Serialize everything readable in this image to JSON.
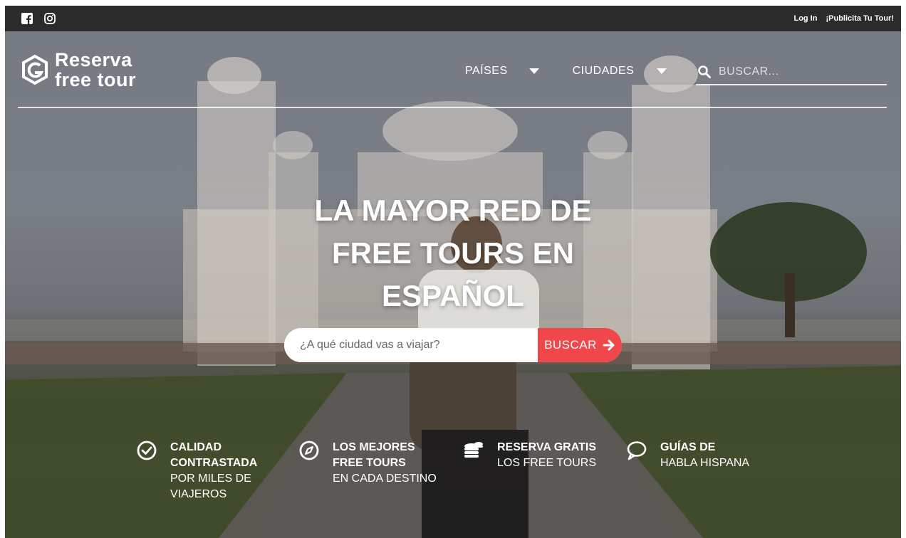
{
  "topbar": {
    "social": [
      {
        "name": "facebook-icon"
      },
      {
        "name": "instagram-icon"
      }
    ],
    "links": [
      "Log In",
      "¡Publicita Tu Tour!"
    ]
  },
  "logo": {
    "line1": "Reserva",
    "line2": "free tour"
  },
  "nav": {
    "items": [
      {
        "label": "PAÍSES"
      },
      {
        "label": "CIUDADES"
      }
    ],
    "search_placeholder": "BUSCAR..."
  },
  "hero": {
    "headline": [
      "LA MAYOR RED DE",
      "FREE TOURS EN",
      "ESPAÑOL"
    ],
    "search_placeholder": "¿A qué ciudad vas a viajar?",
    "search_button": "BUSCAR"
  },
  "features": [
    {
      "icon": "check-circle-icon",
      "bold": [
        "CALIDAD",
        "CONTRASTADA"
      ],
      "normal": [
        "POR MILES DE",
        "VIAJEROS"
      ]
    },
    {
      "icon": "compass-icon",
      "bold": [
        "LOS MEJORES",
        "FREE TOURS"
      ],
      "normal": [
        "EN CADA DESTINO"
      ]
    },
    {
      "icon": "coins-icon",
      "bold": [
        "RESERVA GRATIS"
      ],
      "normal": [
        "LOS FREE TOURS"
      ]
    },
    {
      "icon": "chat-bubble-icon",
      "bold": [
        "GUÍAS DE"
      ],
      "normal": [
        "HABLA HISPANA"
      ]
    }
  ],
  "colors": {
    "topbar": "#2b2b2b",
    "accent": "#f0484a",
    "text_on_hero": "#ffffff"
  }
}
